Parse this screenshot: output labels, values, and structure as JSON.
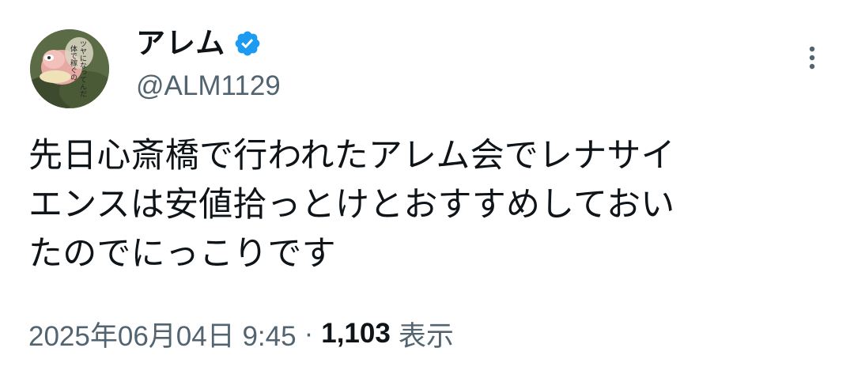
{
  "author": {
    "display_name": "アレム",
    "handle": "@ALM1129",
    "verified_icon": "verified-badge",
    "avatar_text": "ツヤになってんだ 体で稼ぐの"
  },
  "tweet": {
    "text": "先日心斎橋で行われたアレム会でレナサイ\nエンスは安値拾っとけとおすすめしておい\nたのでにっこりです"
  },
  "meta": {
    "timestamp": "2025年06月04日 9:45",
    "separator": "·",
    "views_count": "1,103",
    "views_label": "表示"
  },
  "colors": {
    "text_primary": "#0f1419",
    "text_secondary": "#536471",
    "verified_blue": "#1d9bf0"
  },
  "icons": {
    "more": "more-vertical-icon"
  }
}
